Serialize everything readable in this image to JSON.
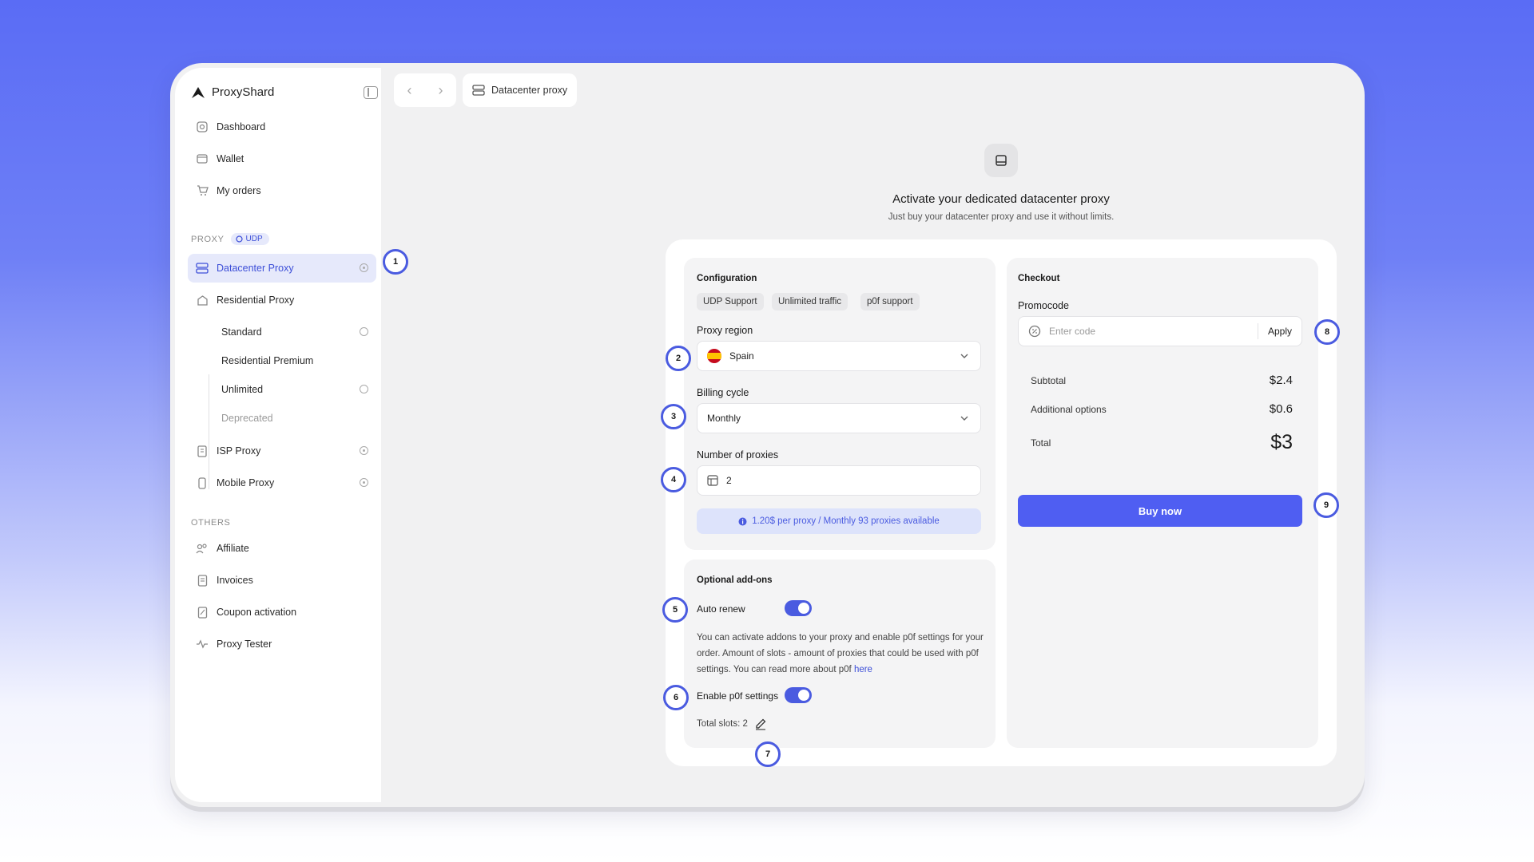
{
  "app": {
    "name": "ProxyShard"
  },
  "nav": {
    "back_icon": "chevron-left-icon",
    "forward_icon": "chevron-right-icon",
    "breadcrumb": "Datacenter proxy"
  },
  "sidebar": {
    "main": [
      {
        "label": "Dashboard",
        "icon": "dashboard-icon"
      },
      {
        "label": "Wallet",
        "icon": "wallet-icon"
      },
      {
        "label": "My orders",
        "icon": "cart-icon"
      }
    ],
    "proxy_section": {
      "label": "PROXY",
      "badge": "UDP"
    },
    "proxy_items": [
      {
        "label": "Datacenter Proxy",
        "active": true
      },
      {
        "label": "Residential Proxy"
      },
      {
        "label": "ISP Proxy"
      },
      {
        "label": "Mobile Proxy"
      }
    ],
    "residential_sub": [
      {
        "label": "Standard"
      },
      {
        "label": "Residential Premium"
      },
      {
        "label": "Unlimited"
      },
      {
        "label": "Deprecated"
      }
    ],
    "others_section": {
      "label": "OTHERS"
    },
    "others_items": [
      {
        "label": "Affiliate"
      },
      {
        "label": "Invoices"
      },
      {
        "label": "Coupon activation"
      },
      {
        "label": "Proxy Tester"
      }
    ]
  },
  "hero": {
    "title": "Activate your dedicated datacenter proxy",
    "subtitle": "Just buy your datacenter proxy and use it without limits."
  },
  "configuration": {
    "title": "Configuration",
    "chips": [
      "UDP Support",
      "Unlimited traffic",
      "p0f support"
    ],
    "region_label": "Proxy region",
    "region_value": "Spain",
    "billing_label": "Billing cycle",
    "billing_value": "Monthly",
    "count_label": "Number of proxies",
    "count_value": "2",
    "info": "1.20$ per proxy / Monthly 93 proxies available"
  },
  "addons": {
    "title": "Optional add-ons",
    "auto_renew_label": "Auto renew",
    "auto_renew_on": true,
    "description": "You can activate addons to your proxy and enable p0f settings for your order. Amount of slots - amount of proxies that could be used with p0f settings. You can read more about p0f",
    "link_text": "here",
    "p0f_label": "Enable p0f settings",
    "p0f_on": true,
    "total_slots": "Total slots: 2"
  },
  "checkout": {
    "title": "Checkout",
    "promo_label": "Promocode",
    "promo_placeholder": "Enter code",
    "apply_label": "Apply",
    "subtotal_label": "Subtotal",
    "subtotal_value": "$2.4",
    "additional_label": "Additional options",
    "additional_value": "$0.6",
    "total_label": "Total",
    "total_value": "$3",
    "buy_label": "Buy now"
  },
  "callouts": [
    "1",
    "2",
    "3",
    "4",
    "5",
    "6",
    "7",
    "8",
    "9"
  ],
  "colors": {
    "accent": "#4f5ef2",
    "active_bg": "#e6e9fb",
    "info_bg": "#dde3fb"
  }
}
